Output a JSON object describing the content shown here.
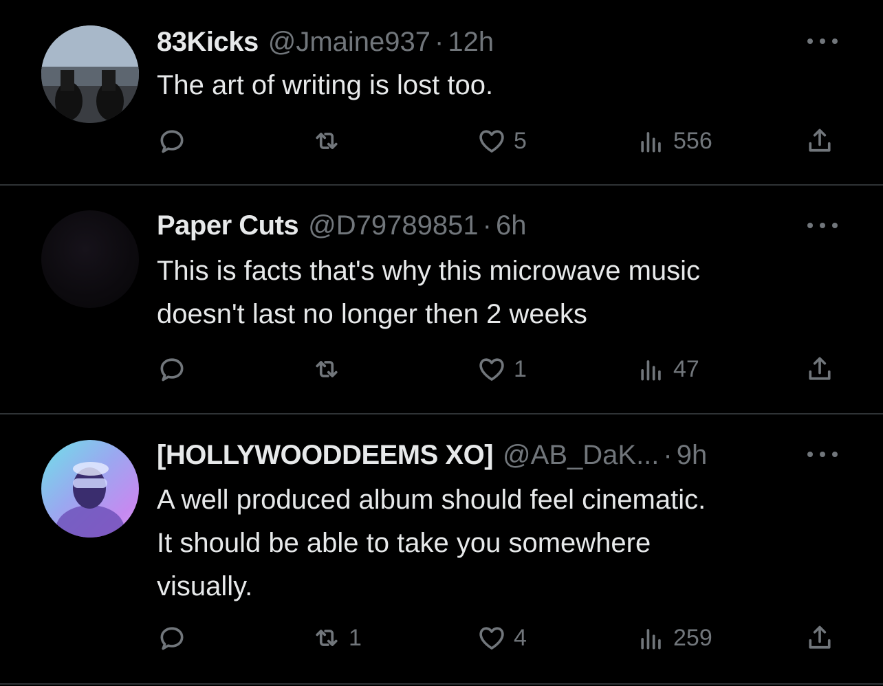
{
  "tweets": [
    {
      "name": "83Kicks",
      "handle": "@Jmaine937",
      "separator": "·",
      "time": "12h",
      "text": "The art of writing is lost too.",
      "replies": "",
      "retweets": "",
      "likes": "5",
      "views": "556"
    },
    {
      "name": "Paper Cuts",
      "handle": "@D79789851",
      "separator": "·",
      "time": "6h",
      "text": "This is facts that's why this microwave music\ndoesn't last no longer then 2 weeks",
      "replies": "",
      "retweets": "",
      "likes": "1",
      "views": "47"
    },
    {
      "name": "[HOLLYWOODDEEMS XO]",
      "handle": "@AB_DaK...",
      "separator": "·",
      "time": "9h",
      "text": "A well produced album should feel cinematic.\nIt should be able to take you somewhere\nvisually.",
      "replies": "",
      "retweets": "1",
      "likes": "4",
      "views": "259"
    }
  ],
  "icons": {
    "reply": "reply-icon",
    "retweet": "retweet-icon",
    "like": "heart-icon",
    "views": "views-icon",
    "share": "share-icon",
    "more": "more-icon"
  },
  "colors": {
    "background": "#000000",
    "text_primary": "#e7e9ea",
    "text_secondary": "#71767b",
    "divider": "#2f3336"
  }
}
